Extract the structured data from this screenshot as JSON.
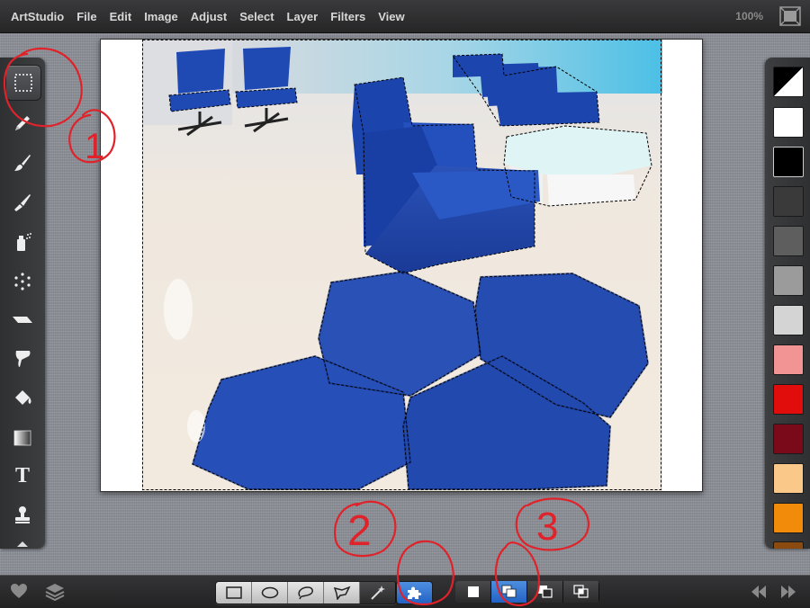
{
  "menu": {
    "app": "ArtStudio",
    "items": [
      "File",
      "Edit",
      "Image",
      "Adjust",
      "Select",
      "Layer",
      "Filters",
      "View"
    ],
    "zoom": "100%"
  },
  "left_tools": [
    {
      "name": "rectangle-select-icon",
      "active": true
    },
    {
      "name": "pencil-icon"
    },
    {
      "name": "brush-icon"
    },
    {
      "name": "wide-brush-icon"
    },
    {
      "name": "spray-can-icon"
    },
    {
      "name": "scatter-brush-icon"
    },
    {
      "name": "eraser-icon"
    },
    {
      "name": "smudge-icon"
    },
    {
      "name": "paint-bucket-icon"
    },
    {
      "name": "gradient-icon"
    },
    {
      "name": "text-icon",
      "label": "T"
    },
    {
      "name": "stamp-icon"
    }
  ],
  "palette": [
    "#ffffff",
    "#000000",
    "#3a3a3a",
    "#5e5e5e",
    "#9b9b9b",
    "#d4d4d4",
    "#f29494",
    "#e10d0d",
    "#7a0a1a",
    "#fac98a",
    "#f28a0a",
    "#8a4a10"
  ],
  "selection_shapes": [
    "rectangle",
    "ellipse",
    "lasso",
    "polygon",
    "magic-wand"
  ],
  "selection_modes": [
    "new",
    "add",
    "subtract",
    "intersect"
  ],
  "annotations": [
    "1",
    "2",
    "3"
  ],
  "colors": {
    "accent_blue": "#2a6bd0",
    "annotation_red": "#e0222a"
  }
}
